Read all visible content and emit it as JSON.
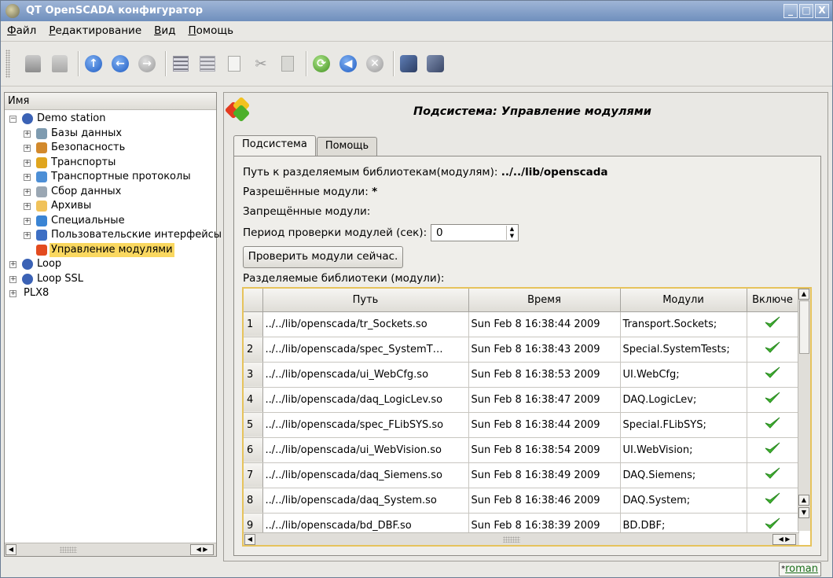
{
  "window": {
    "title": "QT OpenSCADA конфигуратор",
    "buttons": [
      "_",
      "□",
      "X"
    ]
  },
  "menu": [
    "Файл",
    "Редактирование",
    "Вид",
    "Помощь"
  ],
  "toolbar": {
    "icons": [
      "database-load-icon",
      "database-save-icon",
      "up-icon",
      "back-icon",
      "forward-icon",
      "item-add-icon",
      "item-delete-icon",
      "copy-icon",
      "cut-icon",
      "paste-icon",
      "refresh-icon",
      "start-icon",
      "stop-icon",
      "db-load-icon",
      "db-save-icon"
    ]
  },
  "tree": {
    "header": "Имя",
    "items": [
      {
        "label": "Demo station",
        "level": 0,
        "expand": "−",
        "icon": "station-icon"
      },
      {
        "label": "Базы данных",
        "level": 1,
        "expand": "+",
        "icon": "database-icon"
      },
      {
        "label": "Безопасность",
        "level": 1,
        "expand": "+",
        "icon": "security-icon"
      },
      {
        "label": "Транспорты",
        "level": 1,
        "expand": "+",
        "icon": "transport-icon"
      },
      {
        "label": "Транспортные протоколы",
        "level": 1,
        "expand": "+",
        "icon": "protocol-icon"
      },
      {
        "label": "Сбор данных",
        "level": 1,
        "expand": "+",
        "icon": "daq-icon"
      },
      {
        "label": "Архивы",
        "level": 1,
        "expand": "+",
        "icon": "archive-icon"
      },
      {
        "label": "Специальные",
        "level": 1,
        "expand": "+",
        "icon": "special-icon"
      },
      {
        "label": "Пользовательские интерфейсы",
        "level": 1,
        "expand": "+",
        "icon": "ui-icon"
      },
      {
        "label": "Управление модулями",
        "level": 1,
        "expand": "",
        "icon": "modules-icon",
        "selected": true
      },
      {
        "label": "Loop",
        "level": 0,
        "expand": "+",
        "icon": "station-icon"
      },
      {
        "label": "Loop SSL",
        "level": 0,
        "expand": "+",
        "icon": "station-icon"
      },
      {
        "label": "PLX8",
        "level": 0,
        "expand": "+",
        "icon": ""
      }
    ]
  },
  "page": {
    "title": "Подсистема: Управление модулями",
    "tabs": [
      "Подсистема",
      "Помощь"
    ],
    "active_tab": 0,
    "lib_path_label": "Путь к разделяемым библиотекам(модулям):",
    "lib_path_value": "../../lib/openscada",
    "allowed_label": "Разрешённые модули:",
    "allowed_value": "*",
    "denied_label": "Запрещённые модули:",
    "period_label": "Период проверки модулей (сек):",
    "period_value": "0",
    "check_button": "Проверить модули сейчас.",
    "libs_label": "Разделяемые библиотеки (модули):"
  },
  "table": {
    "columns": [
      "Путь",
      "Время",
      "Модули",
      "Включе"
    ],
    "rows": [
      {
        "n": "1",
        "path": "../../lib/openscada/tr_Sockets.so",
        "time": "Sun Feb  8 16:38:44 2009",
        "modules": "Transport.Sockets;",
        "enabled": true
      },
      {
        "n": "2",
        "path": "../../lib/openscada/spec_SystemT…",
        "time": "Sun Feb  8 16:38:43 2009",
        "modules": "Special.SystemTests;",
        "enabled": true
      },
      {
        "n": "3",
        "path": "../../lib/openscada/ui_WebCfg.so",
        "time": "Sun Feb  8 16:38:53 2009",
        "modules": "UI.WebCfg;",
        "enabled": true
      },
      {
        "n": "4",
        "path": "../../lib/openscada/daq_LogicLev.so",
        "time": "Sun Feb  8 16:38:47 2009",
        "modules": "DAQ.LogicLev;",
        "enabled": true
      },
      {
        "n": "5",
        "path": "../../lib/openscada/spec_FLibSYS.so",
        "time": "Sun Feb  8 16:38:44 2009",
        "modules": "Special.FLibSYS;",
        "enabled": true
      },
      {
        "n": "6",
        "path": "../../lib/openscada/ui_WebVision.so",
        "time": "Sun Feb  8 16:38:54 2009",
        "modules": "UI.WebVision;",
        "enabled": true
      },
      {
        "n": "7",
        "path": "../../lib/openscada/daq_Siemens.so",
        "time": "Sun Feb  8 16:38:49 2009",
        "modules": "DAQ.Siemens;",
        "enabled": true
      },
      {
        "n": "8",
        "path": "../../lib/openscada/daq_System.so",
        "time": "Sun Feb  8 16:38:46 2009",
        "modules": "DAQ.System;",
        "enabled": true
      },
      {
        "n": "9",
        "path": "../../lib/openscada/bd_DBF.so",
        "time": "Sun Feb  8 16:38:39 2009",
        "modules": "BD.DBF;",
        "enabled": true
      }
    ]
  },
  "status": {
    "marker": "*",
    "user": "roman"
  },
  "colors": {
    "selection": "#fad860",
    "title_bar": "#7f9cc6",
    "check": "#3fb52f",
    "table_focus": "#e6c35c"
  }
}
